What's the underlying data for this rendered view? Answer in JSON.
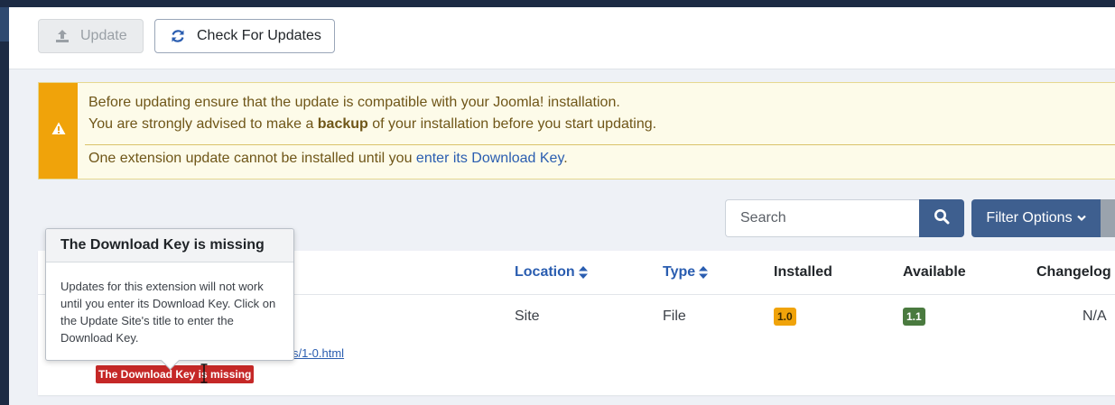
{
  "toolbar": {
    "update_label": "Update",
    "check_label": "Check For Updates"
  },
  "alert": {
    "line1": "Before updating ensure that the update is compatible with your Joomla! installation.",
    "line2_pre": "You are strongly advised to make a ",
    "line2_bold": "backup",
    "line2_post": " of your installation before you start updating.",
    "line3_pre": "One extension update cannot be installed until you ",
    "line3_link": "enter its Download Key",
    "line3_post": "."
  },
  "search": {
    "placeholder": "Search",
    "filter_label": "Filter Options"
  },
  "table": {
    "headers": {
      "location": "Location",
      "type": "Type",
      "installed": "Installed",
      "available": "Available",
      "changelog": "Changelog"
    },
    "row": {
      "location": "Site",
      "type": "File",
      "installed": "1.0",
      "available": "1.1",
      "changelog": "N/A",
      "link_fragment": "s/1-0.html",
      "key_badge": "The Download Key is missing"
    }
  },
  "tooltip": {
    "title": "The Download Key is missing",
    "body": "Updates for this extension will not work until you enter its Download Key. Click on the Update Site's title to enter the Download Key."
  },
  "icons": {
    "update": "upload-icon",
    "check": "sync-icon",
    "alert": "warning-icon",
    "search": "search-icon",
    "filter": "chevron-down-icon",
    "sort": "sort-icon"
  },
  "colors": {
    "primary": "#3e5f8f",
    "warning": "#f0a30a",
    "success": "#4a7a3f",
    "danger": "#c52827",
    "link": "#2a5db0"
  }
}
